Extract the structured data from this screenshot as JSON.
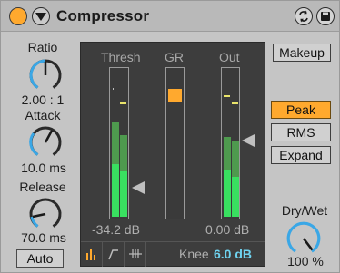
{
  "device": {
    "title": "Compressor",
    "on": true,
    "icons": {
      "power": "power-toggle-icon",
      "fold": "fold-triangle-icon",
      "hot_swap": "hot-swap-icon",
      "save": "save-preset-icon"
    }
  },
  "left": {
    "ratio": {
      "label": "Ratio",
      "value": "2.00 : 1"
    },
    "attack": {
      "label": "Attack",
      "value": "10.0 ms"
    },
    "release": {
      "label": "Release",
      "value": "70.0 ms"
    },
    "auto_label": "Auto"
  },
  "meters": {
    "thresh_label": "Thresh",
    "gr_label": "GR",
    "out_label": "Out",
    "thresh_value": "-34.2 dB",
    "out_value": "0.00 dB"
  },
  "bottom": {
    "knee_label": "Knee",
    "knee_value": "6.0 dB",
    "view_icons": [
      "activity-view-icon",
      "curve-view-icon",
      "collapsed-view-icon"
    ]
  },
  "right": {
    "makeup_label": "Makeup",
    "modes": [
      {
        "label": "Peak",
        "active": true
      },
      {
        "label": "RMS",
        "active": false
      },
      {
        "label": "Expand",
        "active": false
      }
    ],
    "drywet": {
      "label": "Dry/Wet",
      "value": "100 %"
    }
  },
  "colors": {
    "accent_orange": "#ffa92e",
    "meter_green_bright": "#39e060",
    "meter_green_dim": "#4e9a4e",
    "knob_blue": "#3aa7e6",
    "knee_value_blue": "#6fd3f0",
    "panel_bg": "#3d3d3d"
  }
}
